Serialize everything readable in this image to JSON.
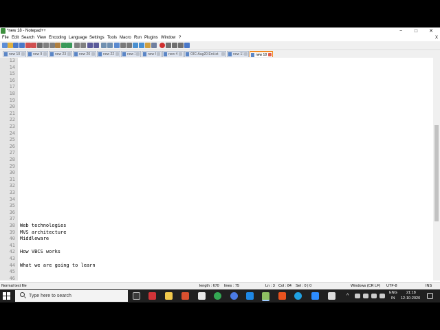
{
  "window": {
    "title": "*new 18 - Notepad++",
    "controls": {
      "minimize": "−",
      "maximize": "□",
      "close": "✕"
    }
  },
  "menu": {
    "items": [
      "File",
      "Edit",
      "Search",
      "View",
      "Encoding",
      "Language",
      "Settings",
      "Tools",
      "Macro",
      "Run",
      "Plugins",
      "Window",
      "?"
    ],
    "close_glyph": "X"
  },
  "toolbar": {
    "icons": [
      "new-icon",
      "open-icon",
      "save-icon",
      "save-all-icon",
      "close-icon",
      "close-all-icon",
      "print-icon",
      "cut-icon",
      "copy-icon",
      "paste-icon",
      "undo-icon",
      "redo-icon",
      "find-icon",
      "replace-icon",
      "zoom-in-icon",
      "zoom-out-icon",
      "sync-v-icon",
      "sync-h-icon",
      "wrap-icon",
      "indent-guide-icon",
      "all-chars-icon",
      "doc-map-icon",
      "function-list-icon",
      "folder-workspace-icon",
      "monitor-icon",
      "record-icon",
      "stop-icon",
      "play-icon",
      "play-multi-icon",
      "save-macro-icon"
    ]
  },
  "tabs": [
    {
      "label": "new 10"
    },
    {
      "label": "new 9"
    },
    {
      "label": "new 23"
    },
    {
      "label": "new 20"
    },
    {
      "label": "new 22"
    },
    {
      "label": "new 3"
    },
    {
      "label": "new 6"
    },
    {
      "label": "new 4"
    },
    {
      "label": "OIC-Aug20 Ent.txt"
    },
    {
      "label": "new 17"
    },
    {
      "label": "new 18",
      "active": true
    }
  ],
  "editor": {
    "lines": [
      {
        "n": "13",
        "t": ""
      },
      {
        "n": "14",
        "t": ""
      },
      {
        "n": "15",
        "t": ""
      },
      {
        "n": "16",
        "t": ""
      },
      {
        "n": "17",
        "t": ""
      },
      {
        "n": "18",
        "t": ""
      },
      {
        "n": "19",
        "t": ""
      },
      {
        "n": "20",
        "t": ""
      },
      {
        "n": "21",
        "t": ""
      },
      {
        "n": "22",
        "t": ""
      },
      {
        "n": "23",
        "t": ""
      },
      {
        "n": "24",
        "t": ""
      },
      {
        "n": "25",
        "t": ""
      },
      {
        "n": "26",
        "t": ""
      },
      {
        "n": "27",
        "t": ""
      },
      {
        "n": "28",
        "t": ""
      },
      {
        "n": "29",
        "t": ""
      },
      {
        "n": "30",
        "t": ""
      },
      {
        "n": "31",
        "t": ""
      },
      {
        "n": "32",
        "t": ""
      },
      {
        "n": "33",
        "t": ""
      },
      {
        "n": "34",
        "t": ""
      },
      {
        "n": "35",
        "t": ""
      },
      {
        "n": "36",
        "t": ""
      },
      {
        "n": "37",
        "t": ""
      },
      {
        "n": "38",
        "t": "Web technologies"
      },
      {
        "n": "39",
        "t": "MVS architecture"
      },
      {
        "n": "40",
        "t": "Middleware"
      },
      {
        "n": "41",
        "t": ""
      },
      {
        "n": "42",
        "t": "How VBCS works"
      },
      {
        "n": "43",
        "t": ""
      },
      {
        "n": "44",
        "t": "What we are going to learn"
      },
      {
        "n": "45",
        "t": ""
      },
      {
        "n": "46",
        "t": ""
      }
    ]
  },
  "status": {
    "file_type": "Normal text file",
    "length": "length : 670",
    "lines": "lines : 75",
    "ln": "Ln : 3",
    "col": "Col : 84",
    "sel": "Sel : 0 | 0",
    "eol": "Windows (CR LF)",
    "encoding": "UTF-8",
    "mode": "INS"
  },
  "taskbar": {
    "search_placeholder": "Type here to search",
    "language": "ENG",
    "region": "IN",
    "time": "21:18",
    "date": "12-10-2020",
    "tray_chevron": "^"
  },
  "colors": {
    "accent": "#f28b22",
    "taskbar": "#202020",
    "gutter": "#e4e4e4"
  }
}
